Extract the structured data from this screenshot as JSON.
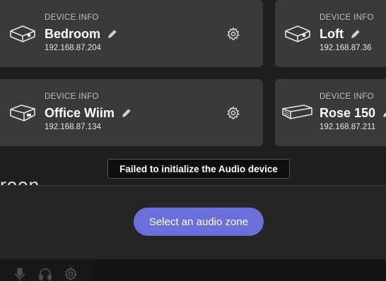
{
  "devices": [
    {
      "caption": "DEVICE INFO",
      "name": "Bedroom",
      "ip": "192.168.87.204",
      "icon": "speaker-box-icon"
    },
    {
      "caption": "DEVICE INFO",
      "name": "Loft",
      "ip": "192.168.87.36",
      "icon": "speaker-box-icon"
    },
    {
      "caption": "DEVICE INFO",
      "name": "Office Wiim",
      "ip": "192.168.87.134",
      "icon": "streamer-box-icon"
    },
    {
      "caption": "DEVICE INFO",
      "name": "Rose 150",
      "ip": "192.168.87.211",
      "icon": "amplifier-box-icon"
    }
  ],
  "tooltip": {
    "text": "Failed to initialize the Audio device"
  },
  "partial_logo_text": "roon",
  "zone_button": {
    "label": "Select an audio zone",
    "color": "#6a6fdc"
  },
  "footer": {
    "icons": [
      "microphone-icon",
      "headphones-icon",
      "settings-gear-icon"
    ]
  }
}
